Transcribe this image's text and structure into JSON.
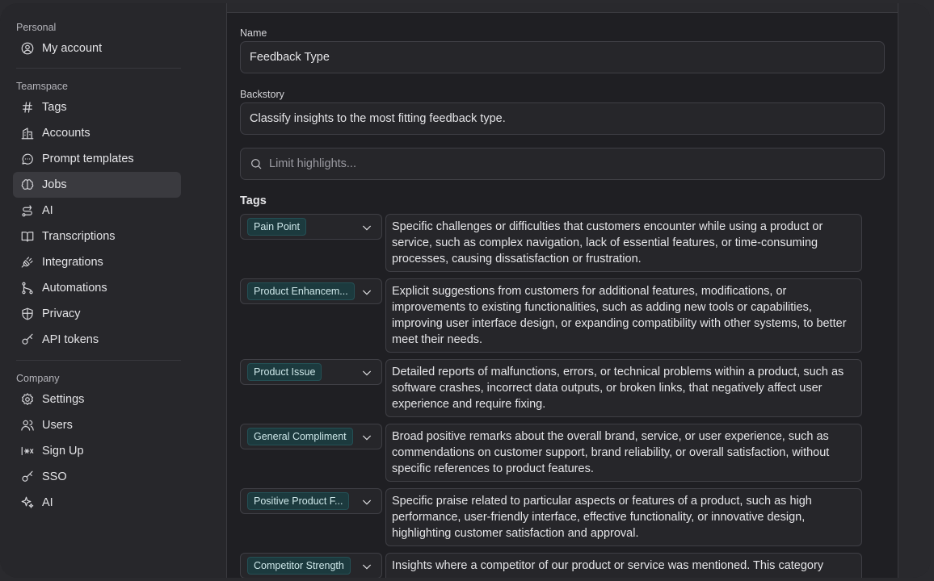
{
  "sidebar": {
    "personal_label": "Personal",
    "teamspace_label": "Teamspace",
    "company_label": "Company",
    "personal_items": [
      {
        "label": "My account",
        "icon": "user-circle-icon"
      }
    ],
    "teamspace_items": [
      {
        "label": "Tags",
        "icon": "hash-icon"
      },
      {
        "label": "Accounts",
        "icon": "building-icon"
      },
      {
        "label": "Prompt templates",
        "icon": "message-dots-icon"
      },
      {
        "label": "Jobs",
        "icon": "brain-icon",
        "active": true
      },
      {
        "label": "AI",
        "icon": "route-icon"
      },
      {
        "label": "Transcriptions",
        "icon": "book-open-icon"
      },
      {
        "label": "Integrations",
        "icon": "plug-icon"
      },
      {
        "label": "Automations",
        "icon": "git-branch-icon"
      },
      {
        "label": "Privacy",
        "icon": "shield-icon"
      },
      {
        "label": "API tokens",
        "icon": "key-icon"
      }
    ],
    "company_items": [
      {
        "label": "Settings",
        "icon": "gear-icon"
      },
      {
        "label": "Users",
        "icon": "users-icon"
      },
      {
        "label": "Sign Up",
        "icon": "password-icon"
      },
      {
        "label": "SSO",
        "icon": "key-icon"
      },
      {
        "label": "AI",
        "icon": "sparkles-icon"
      }
    ]
  },
  "form": {
    "name_label": "Name",
    "name_value": "Feedback Type",
    "backstory_label": "Backstory",
    "backstory_value": "Classify insights to the most fitting feedback type.",
    "search_placeholder": "Limit highlights...",
    "tags_heading": "Tags"
  },
  "tags": [
    {
      "name": "Pain Point",
      "description": "Specific challenges or difficulties that customers encounter while using a product or service, such as complex navigation, lack of essential features, or time-consuming processes, causing dissatisfaction or frustration."
    },
    {
      "name": "Product Enhancem...",
      "description": "Explicit suggestions from customers for additional features, modifications, or improvements to existing functionalities, such as adding new tools or capabilities, improving user interface design, or expanding compatibility with other systems, to better meet their needs."
    },
    {
      "name": "Product Issue",
      "description": "Detailed reports of malfunctions, errors, or technical problems within a product, such as software crashes, incorrect data outputs, or broken links, that negatively affect user experience and require fixing."
    },
    {
      "name": "General Compliment",
      "description": "Broad positive remarks about the overall brand, service, or user experience, such as commendations on customer support, brand reliability, or overall satisfaction, without specific references to product features."
    },
    {
      "name": "Positive Product F...",
      "description": "Specific praise related to particular aspects or features of a product, such as high performance, user-friendly interface, effective functionality, or innovative design, highlighting customer satisfaction and approval."
    },
    {
      "name": "Competitor Strength",
      "description": "Insights where a competitor of our product or service was mentioned. This category"
    }
  ]
}
